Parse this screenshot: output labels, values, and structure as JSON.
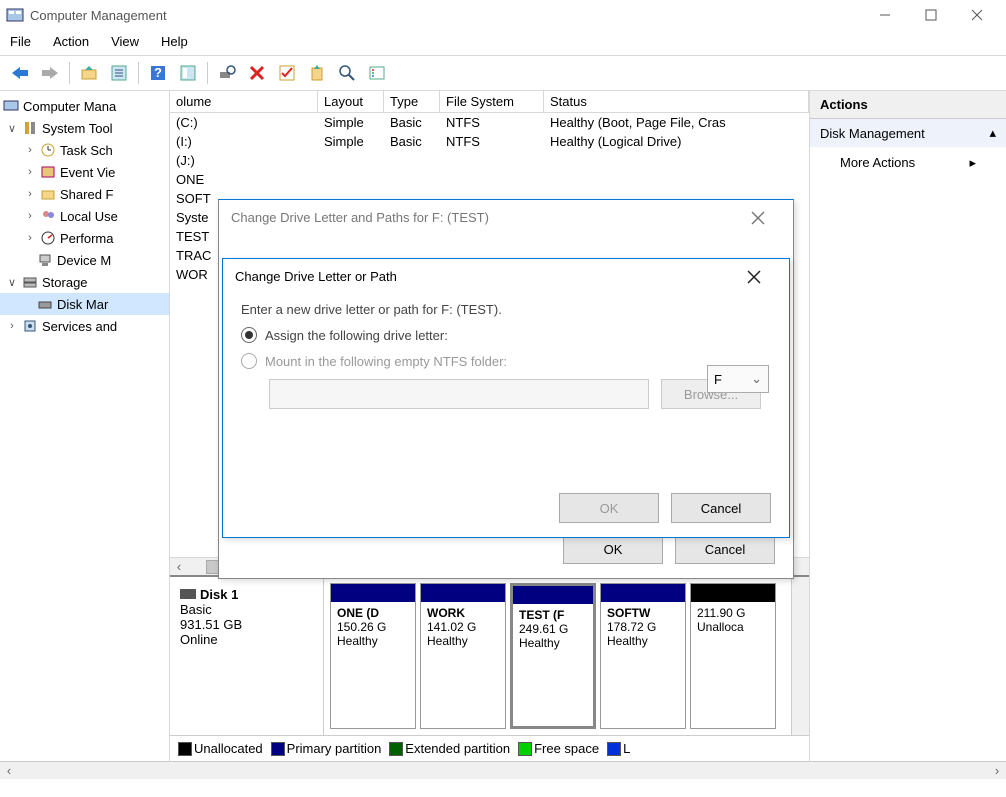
{
  "titlebar": {
    "title": "Computer Management"
  },
  "menubar": [
    "File",
    "Action",
    "View",
    "Help"
  ],
  "tree": {
    "root": "Computer Mana",
    "systools": "System Tool",
    "task": "Task Sch",
    "event": "Event Vie",
    "shared": "Shared F",
    "local": "Local Use",
    "perf": "Performa",
    "device": "Device M",
    "storage": "Storage",
    "diskmgr": "Disk Mar",
    "services": "Services and"
  },
  "cols": {
    "volume": "olume",
    "layout": "Layout",
    "type": "Type",
    "fs": "File System",
    "status": "Status"
  },
  "rows": [
    {
      "vol": "(C:)",
      "layout": "Simple",
      "type": "Basic",
      "fs": "NTFS",
      "status": "Healthy (Boot, Page File, Cras"
    },
    {
      "vol": "(I:)",
      "layout": "Simple",
      "type": "Basic",
      "fs": "NTFS",
      "status": "Healthy (Logical Drive)"
    },
    {
      "vol": "(J:)",
      "layout": "",
      "type": "",
      "fs": "",
      "status": ""
    },
    {
      "vol": "ONE",
      "layout": "",
      "type": "",
      "fs": "",
      "status": ""
    },
    {
      "vol": "SOFT",
      "layout": "",
      "type": "",
      "fs": "",
      "status": ""
    },
    {
      "vol": "Syste",
      "layout": "",
      "type": "",
      "fs": "",
      "status": ""
    },
    {
      "vol": "TEST",
      "layout": "",
      "type": "",
      "fs": "",
      "status": ""
    },
    {
      "vol": "TRAC",
      "layout": "",
      "type": "",
      "fs": "",
      "status": ""
    },
    {
      "vol": "WOR",
      "layout": "",
      "type": "",
      "fs": "",
      "status": ""
    }
  ],
  "disk": {
    "name": "Disk 1",
    "type": "Basic",
    "size": "931.51 GB",
    "status": "Online",
    "parts": [
      {
        "name": "ONE (D",
        "size": "150.26 G",
        "stat": "Healthy"
      },
      {
        "name": "WORK",
        "size": "141.02 G",
        "stat": "Healthy"
      },
      {
        "name": "TEST (F",
        "size": "249.61 G",
        "stat": "Healthy"
      },
      {
        "name": "SOFTW",
        "size": "178.72 G",
        "stat": "Healthy"
      },
      {
        "name": "",
        "size": "211.90 G",
        "stat": "Unalloca"
      }
    ]
  },
  "legend": {
    "unalloc": "Unallocated",
    "primary": "Primary partition",
    "ext": "Extended partition",
    "free": "Free space",
    "l": "L"
  },
  "actions": {
    "hdr": "Actions",
    "diskmgmt": "Disk Management",
    "more": "More Actions"
  },
  "dlg_outer": {
    "title": "Change Drive Letter and Paths for F: (TEST)",
    "ok": "OK",
    "cancel": "Cancel"
  },
  "dlg_inner": {
    "title": "Change Drive Letter or Path",
    "prompt": "Enter a new drive letter or path for F: (TEST).",
    "opt1": "Assign the following drive letter:",
    "opt2": "Mount in the following empty NTFS folder:",
    "drive": "F",
    "browse": "Browse...",
    "ok": "OK",
    "cancel": "Cancel"
  }
}
